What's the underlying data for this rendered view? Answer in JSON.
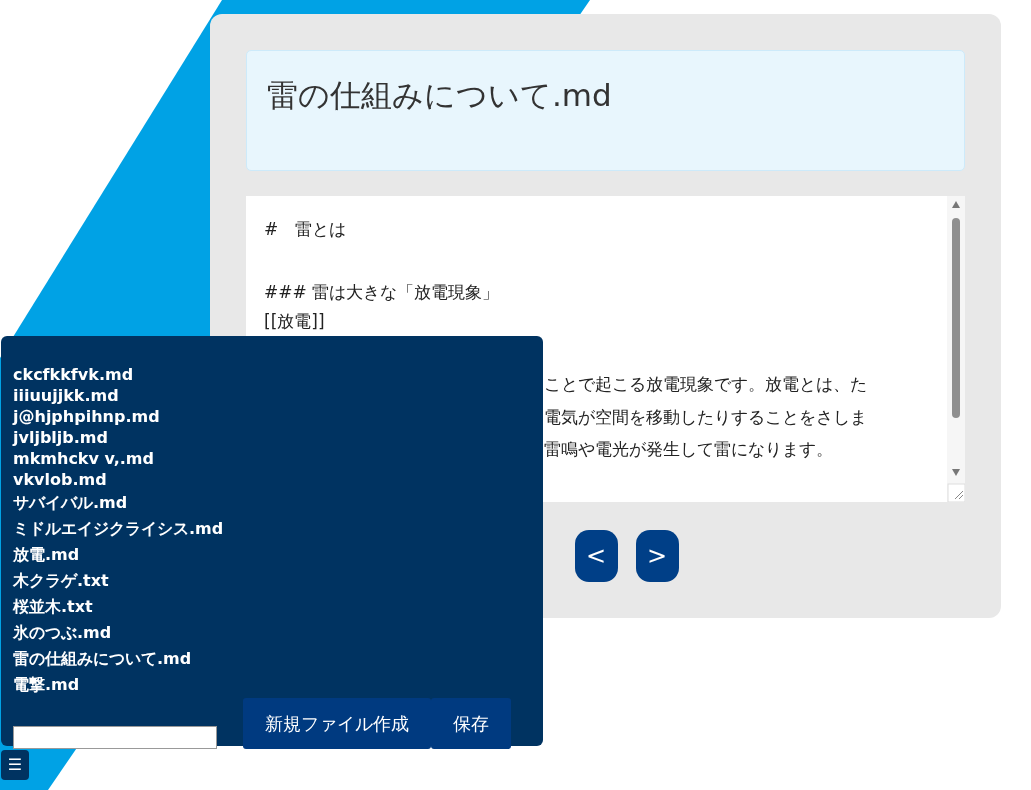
{
  "document": {
    "title": "雷の仕組みについて.md"
  },
  "editor": {
    "lines": [
      {
        "text": "#　雷とは"
      },
      {
        "text": "### 雷は大きな「放電現象」"
      },
      {
        "text": "[[放電]]"
      }
    ],
    "partial_lines": [
      {
        "text": "ことで起こる放電現象です。放電とは、た"
      },
      {
        "text": "電気が空間を移動したりすることをさしま"
      },
      {
        "text": "雷鳴や電光が発生して雷になります。"
      }
    ]
  },
  "nav_buttons": [
    "<",
    ">"
  ],
  "file_panel": {
    "files": [
      {
        "name": "ckcfkkfvk.md"
      },
      {
        "name": "iiiuujjkk.md"
      },
      {
        "name": "j@hjphpihnp.md"
      },
      {
        "name": "jvljbljb.md"
      },
      {
        "name": "mkmhckv v,.md"
      },
      {
        "name": "vkvlob.md"
      },
      {
        "name": "サバイバル.md"
      },
      {
        "name": "ミドルエイジクライシス.md"
      },
      {
        "name": "放電.md"
      },
      {
        "name": "木クラゲ.txt"
      },
      {
        "name": "桜並木.txt"
      },
      {
        "name": "氷のつぶ.md"
      },
      {
        "name": "雷の仕組みについて.md"
      },
      {
        "name": "電撃.md"
      }
    ],
    "buttons": [
      "新規ファイル作成",
      "保存"
    ]
  },
  "menu_toggle": "☰"
}
